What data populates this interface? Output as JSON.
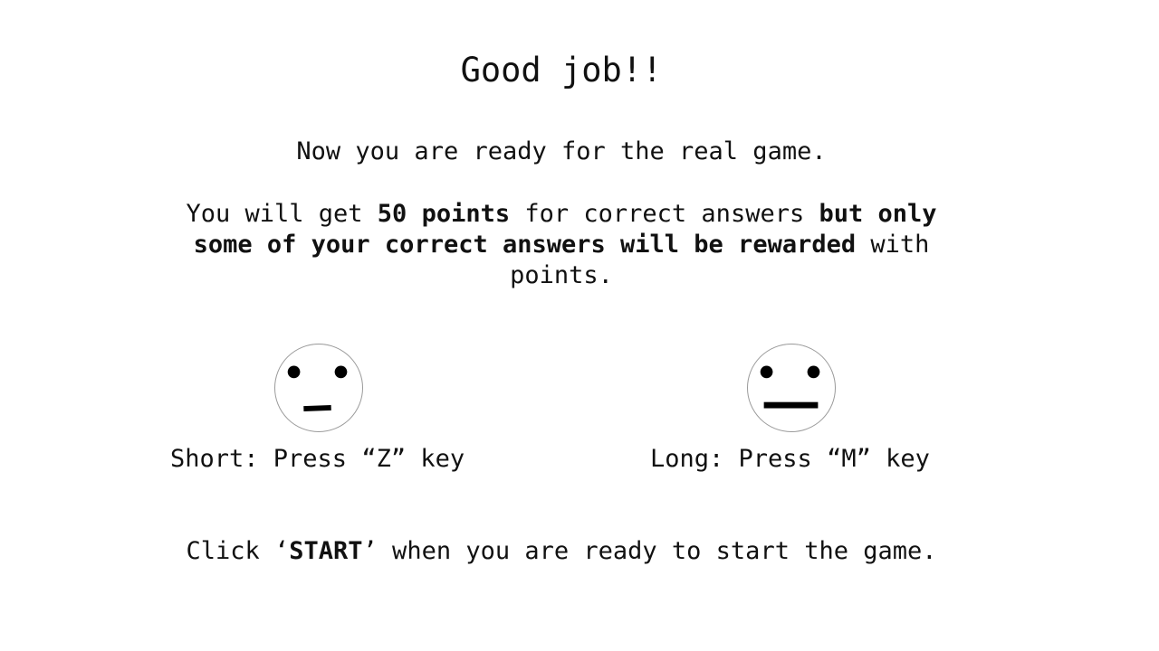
{
  "screen": {
    "title": "Good job!!",
    "intro": "Now you are ready for the real game.",
    "rules": {
      "part1": "You will get ",
      "points_bold": "50 points",
      "part2": " for correct answers ",
      "reward_bold": "but only some of your correct answers will be rewarded",
      "part3": " with points."
    }
  },
  "faces": {
    "short": {
      "icon": "short-mouth-face-icon",
      "label": "Short: Press “Z” key"
    },
    "long": {
      "icon": "long-mouth-face-icon",
      "label": "Long: Press “M” key"
    }
  },
  "start": {
    "prefix": "Click ‘",
    "keyword": "START",
    "suffix": "’ when you are ready to start the game."
  }
}
